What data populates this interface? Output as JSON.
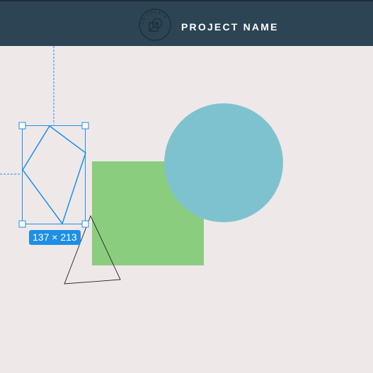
{
  "header": {
    "logo_text": "CO CREATE",
    "project_name": "PROJECT NAME"
  },
  "selection": {
    "size_label": "137 × 213"
  },
  "colors": {
    "header_bg": "#2d4454",
    "canvas_bg": "#efe8e9",
    "square_fill": "#8bcd7f",
    "circle_fill": "#7fc2cf",
    "selection_blue": "#1d8fe6",
    "guide_blue": "#1d8fe6"
  },
  "shapes": [
    "polygon",
    "square",
    "circle",
    "triangle"
  ]
}
